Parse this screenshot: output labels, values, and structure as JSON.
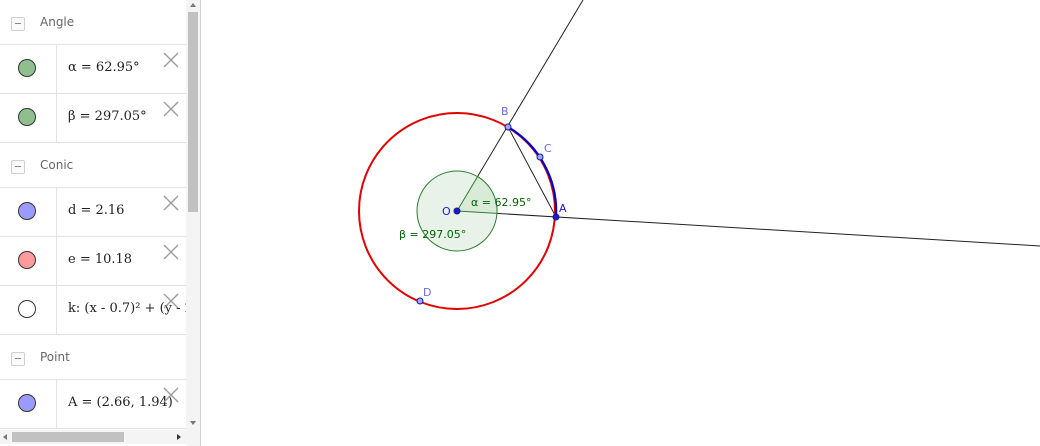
{
  "algebra_view": {
    "groups": [
      {
        "label": "Angle",
        "items": [
          {
            "text": "α = 62.95°",
            "color": "#8fbf8f"
          },
          {
            "text": "β = 297.05°",
            "color": "#8fbf8f"
          }
        ]
      },
      {
        "label": "Conic",
        "items": [
          {
            "text": "d = 2.16",
            "color": "#9b9bff"
          },
          {
            "text": "e = 10.18",
            "color": "#ff9b9b"
          },
          {
            "text": "k: (x - 0.7)² + (y - 2",
            "color": "#ffffff"
          }
        ]
      },
      {
        "label": "Point",
        "items": [
          {
            "text": "A = (2.66, 1.94)",
            "color": "#9b9bff"
          }
        ]
      }
    ]
  },
  "graphics": {
    "points": {
      "O": "O",
      "A": "A",
      "B": "B",
      "C": "C",
      "D": "D"
    },
    "alpha_label": "α = 62.95°",
    "beta_label": "β = 297.05°",
    "colors": {
      "circle": "#e00000",
      "arc": "#0000cc",
      "angle_fill": "#e8f2e8",
      "angle_stroke": "#2e7d32",
      "point": "#4f4fdf",
      "label_point": "#6b6be0"
    }
  }
}
